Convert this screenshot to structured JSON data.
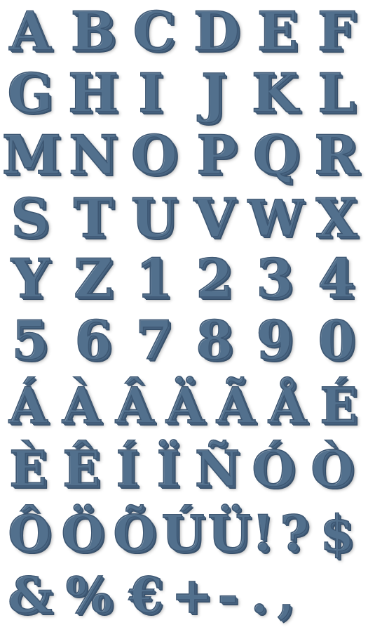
{
  "glyph_sheet": {
    "rows": [
      [
        "A",
        "B",
        "C",
        "D",
        "E",
        "F"
      ],
      [
        "G",
        "H",
        "I",
        "J",
        "K",
        "L"
      ],
      [
        "M",
        "N",
        "O",
        "P",
        "Q",
        "R"
      ],
      [
        "S",
        "T",
        "U",
        "V",
        "W",
        "X"
      ],
      [
        "Y",
        "Z",
        "1",
        "2",
        "3",
        "4"
      ],
      [
        "5",
        "6",
        "7",
        "8",
        "9",
        "0"
      ],
      [
        "Á",
        "À",
        "Â",
        "Ä",
        "Ã",
        "Å",
        "É"
      ],
      [
        "È",
        "Ê",
        "Í",
        "Ï",
        "Ñ",
        "Ó",
        "Ò"
      ],
      [
        "Ô",
        "Ö",
        "Õ",
        "Ú",
        "Ü",
        "!",
        "?",
        "$"
      ],
      [
        "&",
        "%",
        "€",
        "+",
        "-",
        ".",
        ","
      ]
    ],
    "colors": {
      "face": "#8e9fb1",
      "outline": "#3d5773",
      "extrusion": "#46627f",
      "background": "#ffffff"
    }
  }
}
